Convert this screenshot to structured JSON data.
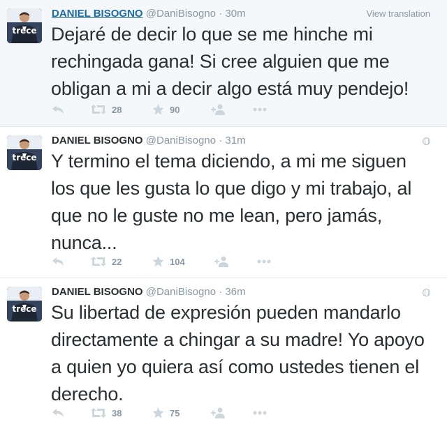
{
  "tweets": [
    {
      "name": "DANIEL BISOGNO",
      "handle": "@DaniBisogno",
      "time": "30m",
      "meta": "View translation",
      "text": "Dejaré de decir lo que se me hinche mi rechingada gana! Si cree alguien que me obligan a mi a decir algo está muy pendejo!",
      "retweets": "28",
      "favorites": "90"
    },
    {
      "name": "DANIEL BISOGNO",
      "handle": "@DaniBisogno",
      "time": "31m",
      "text": "Y termino el tema diciendo, a mi me siguen los que les gusta lo que digo y mi trabajo, al que no le guste no me lean, pero jamás, nunca...",
      "retweets": "22",
      "favorites": "104"
    },
    {
      "name": "DANIEL BISOGNO",
      "handle": "@DaniBisogno",
      "time": "36m",
      "text": "Su libertad de expresión pueden mandarlo directamente a chingar a su madre! Yo apoyo a quien yo quiera así como ustedes tienen el derecho.",
      "retweets": "38",
      "favorites": "75"
    }
  ],
  "dot": "·",
  "avatar_logo": "trece",
  "icons": {
    "reply": "reply-icon",
    "retweet": "retweet-icon",
    "favorite": "star-icon",
    "follow": "follow-icon",
    "more": "more-icon",
    "globe": "globe-icon"
  }
}
